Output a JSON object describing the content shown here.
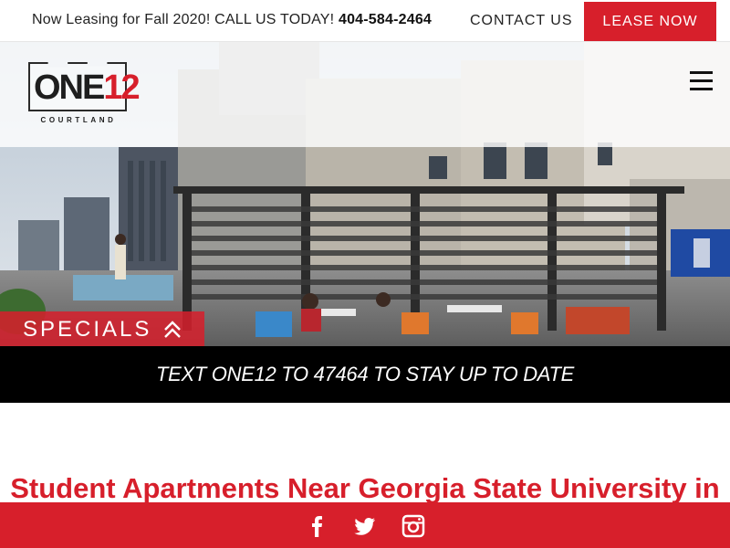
{
  "topbar": {
    "leasing_text": "Now Leasing for Fall 2020! CALL US TODAY!",
    "phone": "404-584-2464",
    "contact_label": "CONTACT US",
    "lease_label": "LEASE NOW"
  },
  "logo": {
    "word": "ONE",
    "number": "12",
    "subtitle": "COURTLAND"
  },
  "nav": {
    "menu_icon": "hamburger-menu-icon"
  },
  "hero": {
    "specials_label": "SPECIALS",
    "specials_icon": "double-chevron-up-icon"
  },
  "textbar": {
    "message": "TEXT ONE12 TO 47464 TO STAY UP TO DATE"
  },
  "content": {
    "headline": "Student Apartments Near Georgia State University in"
  },
  "footer": {
    "icons": [
      "facebook-icon",
      "twitter-icon",
      "instagram-icon"
    ]
  },
  "colors": {
    "accent": "#d71f2b",
    "text": "#222222",
    "black_bar": "#000000"
  }
}
